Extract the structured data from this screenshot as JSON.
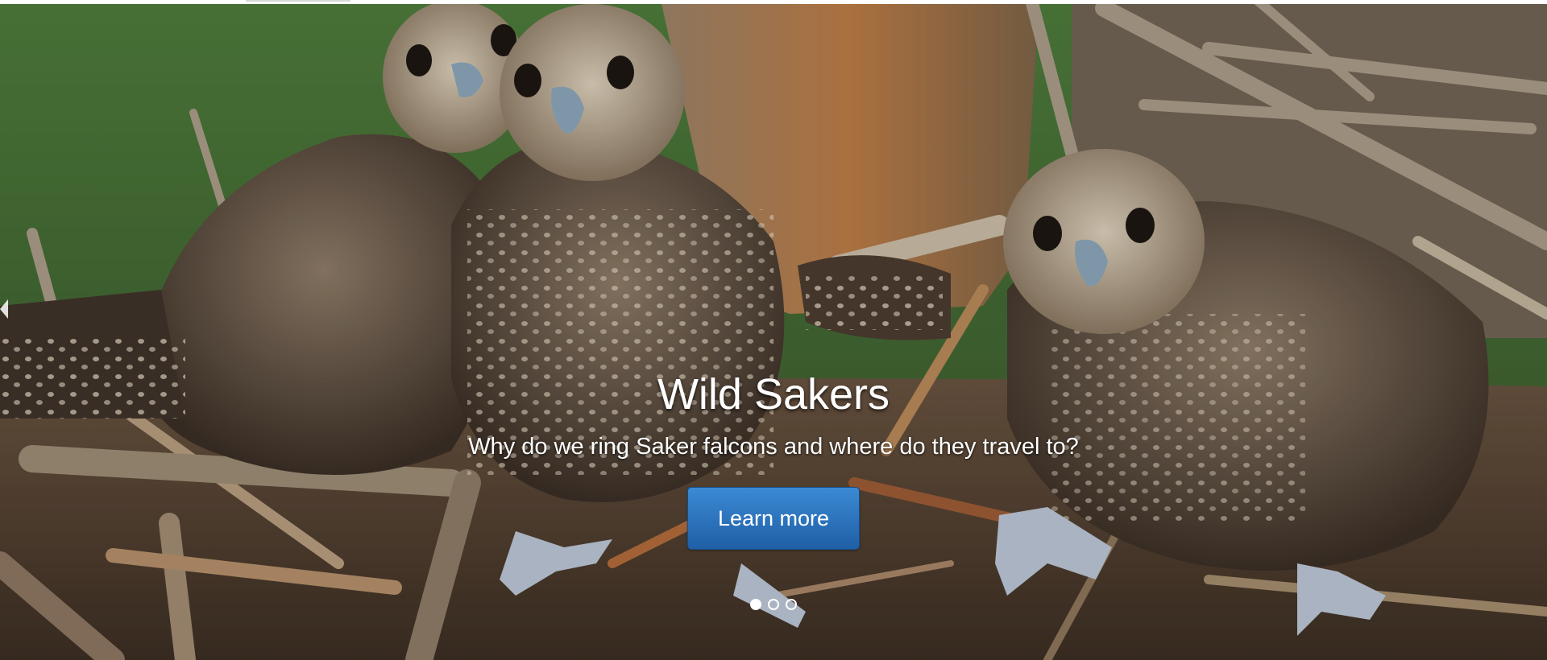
{
  "slide": {
    "title": "Wild Sakers",
    "subtitle": "Why do we ring Saker falcons and where do they travel to?",
    "button_label": "Learn more"
  },
  "carousel": {
    "active_index": 0,
    "total": 3
  },
  "colors": {
    "button": "#2a72bd",
    "text": "#ffffff"
  }
}
